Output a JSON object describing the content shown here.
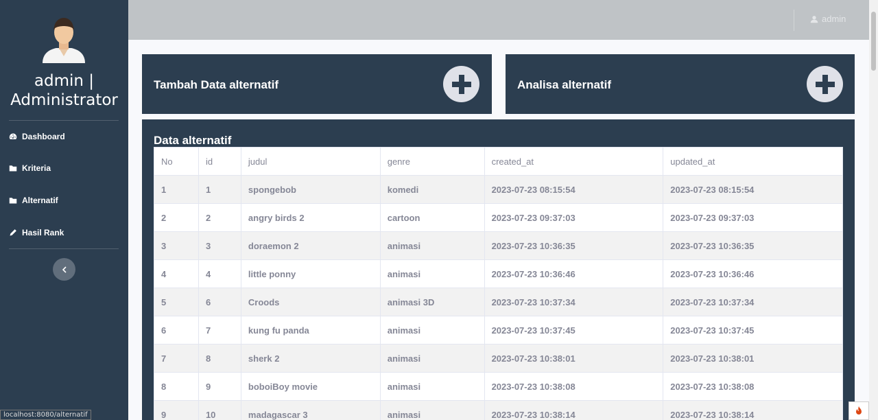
{
  "sidebar": {
    "user_name": "admin | Administrator",
    "items": [
      {
        "label": "Dashboard",
        "icon": "dashboard-icon"
      },
      {
        "label": "Kriteria",
        "icon": "folder-icon"
      },
      {
        "label": "Alternatif",
        "icon": "folder-icon"
      },
      {
        "label": "Hasil Rank",
        "icon": "pencil-icon"
      }
    ],
    "status_url": "localhost:8080/alternatif"
  },
  "topbar": {
    "user_label": "admin"
  },
  "cards": [
    {
      "title": "Tambah Data alternatif"
    },
    {
      "title": "Analisa alternatif"
    }
  ],
  "panel": {
    "title": "Data alternatif",
    "columns": [
      "No",
      "id",
      "judul",
      "genre",
      "created_at",
      "updated_at"
    ],
    "rows": [
      [
        "1",
        "1",
        "spongebob",
        "komedi",
        "2023-07-23 08:15:54",
        "2023-07-23 08:15:54"
      ],
      [
        "2",
        "2",
        "angry birds 2",
        "cartoon",
        "2023-07-23 09:37:03",
        "2023-07-23 09:37:03"
      ],
      [
        "3",
        "3",
        "doraemon 2",
        "animasi",
        "2023-07-23 10:36:35",
        "2023-07-23 10:36:35"
      ],
      [
        "4",
        "4",
        "little ponny",
        "animasi",
        "2023-07-23 10:36:46",
        "2023-07-23 10:36:46"
      ],
      [
        "5",
        "6",
        "Croods",
        "animasi 3D",
        "2023-07-23 10:37:34",
        "2023-07-23 10:37:34"
      ],
      [
        "6",
        "7",
        "kung fu panda",
        "animasi",
        "2023-07-23 10:37:45",
        "2023-07-23 10:37:45"
      ],
      [
        "7",
        "8",
        "sherk 2",
        "animasi",
        "2023-07-23 10:38:01",
        "2023-07-23 10:38:01"
      ],
      [
        "8",
        "9",
        "boboiBoy movie",
        "animasi",
        "2023-07-23 10:38:08",
        "2023-07-23 10:38:08"
      ],
      [
        "9",
        "10",
        "madagascar 3",
        "animasi",
        "2023-07-23 10:38:14",
        "2023-07-23 10:38:14"
      ]
    ]
  },
  "colors": {
    "sidebar_bg": "#2c3e50",
    "topbar_bg": "#bfc3c6",
    "table_text": "#858796"
  }
}
